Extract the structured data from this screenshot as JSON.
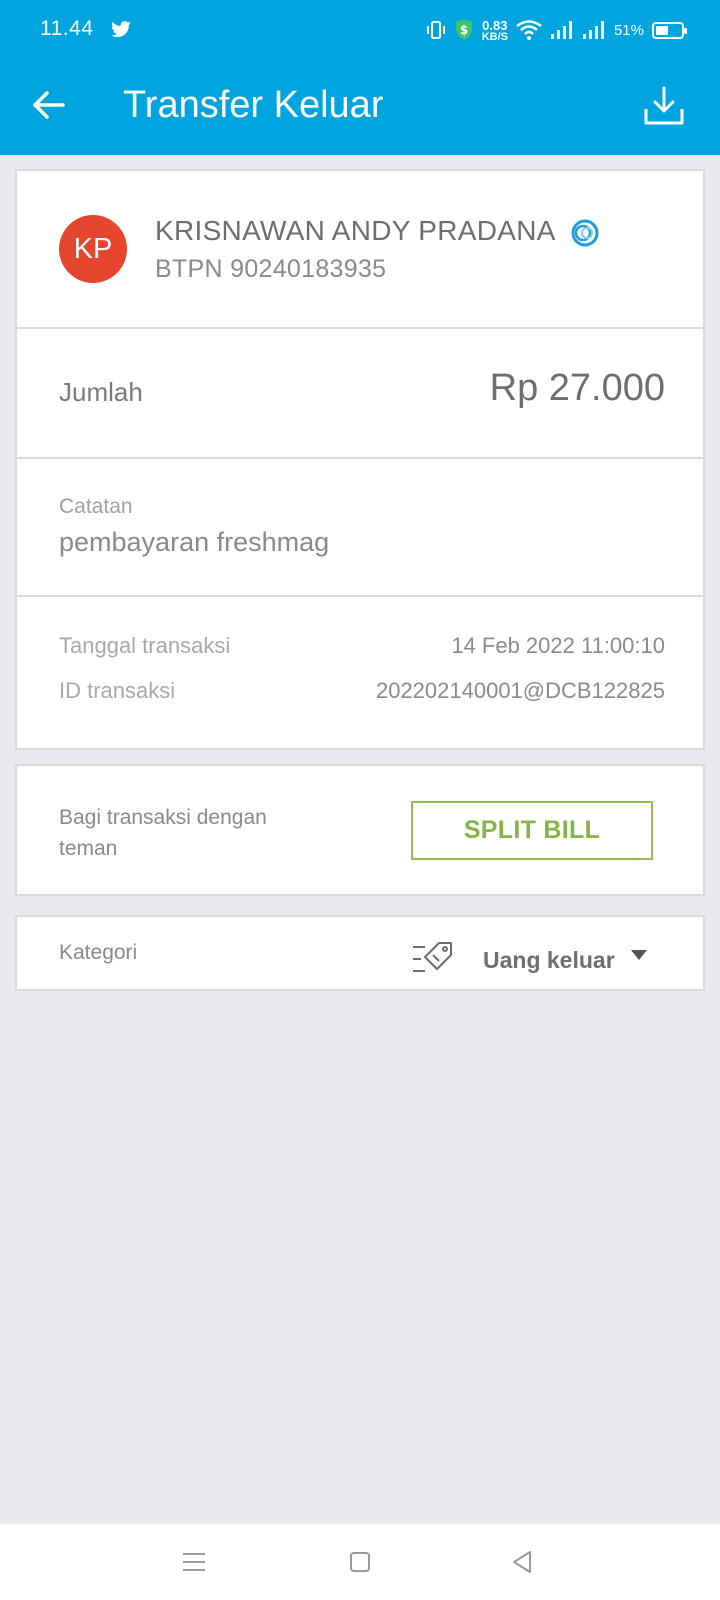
{
  "status_bar": {
    "time": "11.44",
    "net_speed_value": "0.83",
    "net_speed_unit": "KB/S",
    "battery_percent": "51%",
    "battery_level": 0.51
  },
  "header": {
    "title": "Transfer Keluar"
  },
  "recipient": {
    "initials": "KP",
    "name": "KRISNAWAN ANDY PRADANA",
    "account": "BTPN 90240183935"
  },
  "amount": {
    "label": "Jumlah",
    "value": "Rp 27.000"
  },
  "note": {
    "label": "Catatan",
    "value": "pembayaran freshmag"
  },
  "meta": {
    "date_label": "Tanggal transaksi",
    "date_value": "14 Feb 2022 11:00:10",
    "id_label": "ID transaksi",
    "id_value": "202202140001@DCB122825"
  },
  "split": {
    "text": "Bagi transaksi dengan teman",
    "button_label": "SPLIT BILL"
  },
  "category": {
    "label": "Kategori",
    "value": "Uang keluar"
  },
  "colors": {
    "header_blue": "#00a5df",
    "avatar_red": "#e5452d",
    "split_green": "#83b548"
  }
}
